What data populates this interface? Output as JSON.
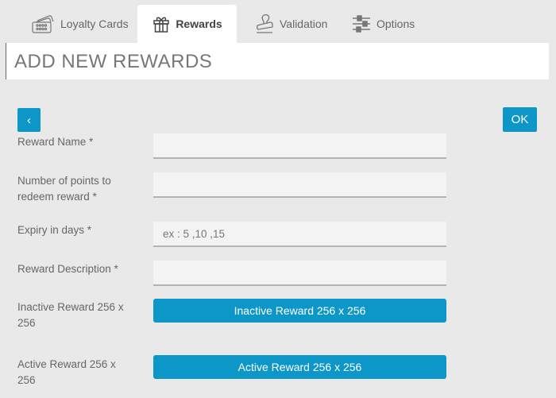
{
  "tabs": [
    {
      "label": "Loyalty Cards",
      "icon": "loyalty-cards-icon",
      "active": false
    },
    {
      "label": "Rewards",
      "icon": "gift-icon",
      "active": true
    },
    {
      "label": "Validation",
      "icon": "stamp-icon",
      "active": false
    },
    {
      "label": "Options",
      "icon": "sliders-icon",
      "active": false
    }
  ],
  "header": {
    "title": "ADD NEW REWARDS"
  },
  "toolbar": {
    "back_label": "‹",
    "ok_label": "OK"
  },
  "form": {
    "reward_name": {
      "label": "Reward Name *",
      "value": "",
      "placeholder": ""
    },
    "points": {
      "label": "Number of points to redeem reward *",
      "value": "",
      "placeholder": ""
    },
    "expiry": {
      "label": "Expiry in days *",
      "value": "",
      "placeholder": "ex : 5 ,10 ,15"
    },
    "description": {
      "label": "Reward Description *",
      "value": "",
      "placeholder": ""
    },
    "inactive_image": {
      "label": "Inactive Reward 256 x 256",
      "button_label": "Inactive Reward 256 x 256"
    },
    "active_image": {
      "label": "Active Reward 256 x 256",
      "button_label": "Active Reward 256 x 256"
    }
  },
  "colors": {
    "accent": "#0d97c8",
    "background": "#e9e9ea",
    "panel": "#ffffff"
  }
}
